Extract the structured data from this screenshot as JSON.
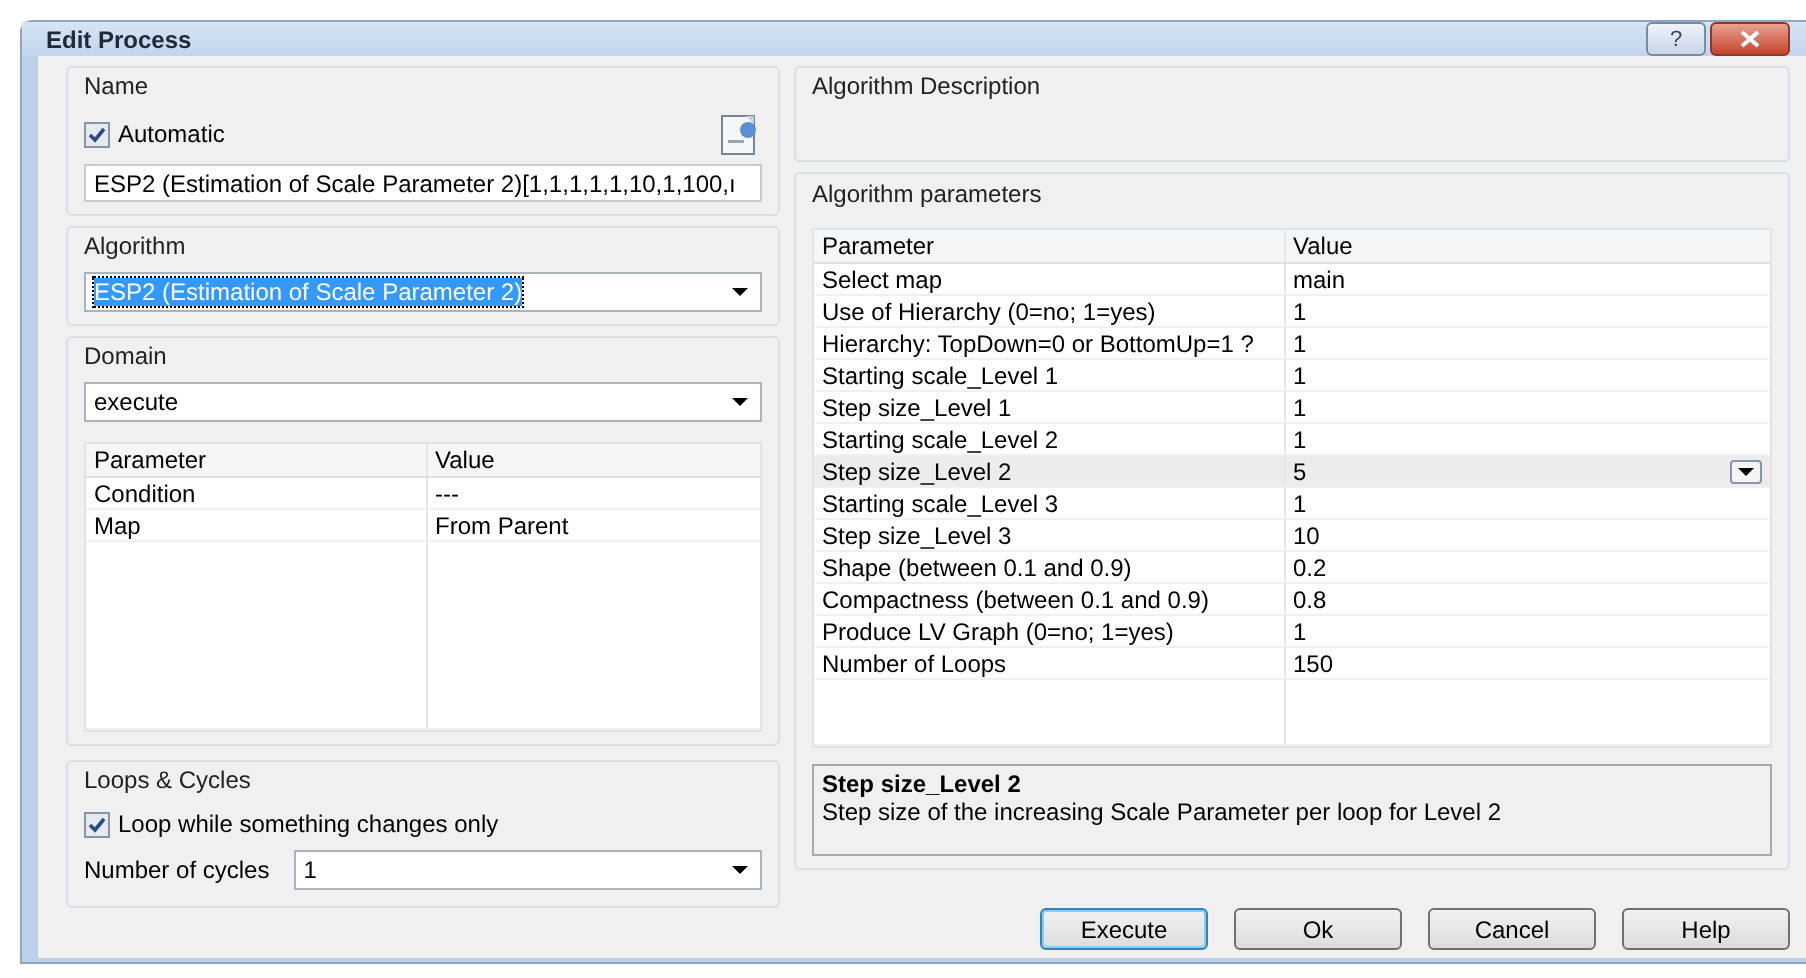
{
  "window": {
    "title": "Edit Process",
    "help_button": "?"
  },
  "name_group": {
    "title": "Name",
    "automatic": {
      "label": "Automatic",
      "checked": true
    },
    "value": "ESP2 (Estimation of Scale Parameter 2)[1,1,1,1,1,10,1,100,ı"
  },
  "algorithm_group": {
    "title": "Algorithm",
    "value": "ESP2 (Estimation of Scale Parameter 2)",
    "text_selected": true
  },
  "domain_group": {
    "title": "Domain",
    "value": "execute",
    "columns": [
      "Parameter",
      "Value"
    ],
    "rows": [
      {
        "parameter": "Condition",
        "value": "---"
      },
      {
        "parameter": "Map",
        "value": "From Parent"
      }
    ]
  },
  "loops_group": {
    "title": "Loops & Cycles",
    "loop_option": {
      "label": "Loop while something changes only",
      "checked": true
    },
    "cycles_label": "Number of cycles",
    "cycles_value": "1"
  },
  "description_group": {
    "title": "Algorithm Description"
  },
  "parameters_group": {
    "title": "Algorithm parameters",
    "columns": [
      "Parameter",
      "Value"
    ],
    "rows": [
      {
        "parameter": "Select map",
        "value": "main",
        "selected": false
      },
      {
        "parameter": "Use of Hierarchy (0=no; 1=yes)",
        "value": "1",
        "selected": false
      },
      {
        "parameter": "Hierarchy: TopDown=0 or BottomUp=1 ?",
        "value": "1",
        "selected": false
      },
      {
        "parameter": "Starting scale_Level 1",
        "value": "1",
        "selected": false
      },
      {
        "parameter": "Step size_Level 1",
        "value": "1",
        "selected": false
      },
      {
        "parameter": "Starting scale_Level 2",
        "value": "1",
        "selected": false
      },
      {
        "parameter": "Step size_Level 2",
        "value": "5",
        "selected": true
      },
      {
        "parameter": "Starting scale_Level 3",
        "value": "1",
        "selected": false
      },
      {
        "parameter": "Step size_Level 3",
        "value": "10",
        "selected": false
      },
      {
        "parameter": "Shape (between 0.1 and 0.9)",
        "value": "0.2",
        "selected": false
      },
      {
        "parameter": "Compactness (between 0.1 and 0.9)",
        "value": "0.8",
        "selected": false
      },
      {
        "parameter": "Produce LV Graph (0=no; 1=yes)",
        "value": "1",
        "selected": false
      },
      {
        "parameter": "Number of Loops",
        "value": "150",
        "selected": false
      }
    ],
    "help_title": "Step size_Level 2",
    "help_text": "Step size of the increasing Scale Parameter per loop for Level 2"
  },
  "buttons": [
    {
      "label": "Execute",
      "default": true
    },
    {
      "label": "Ok",
      "default": false
    },
    {
      "label": "Cancel",
      "default": false
    },
    {
      "label": "Help",
      "default": false
    }
  ]
}
